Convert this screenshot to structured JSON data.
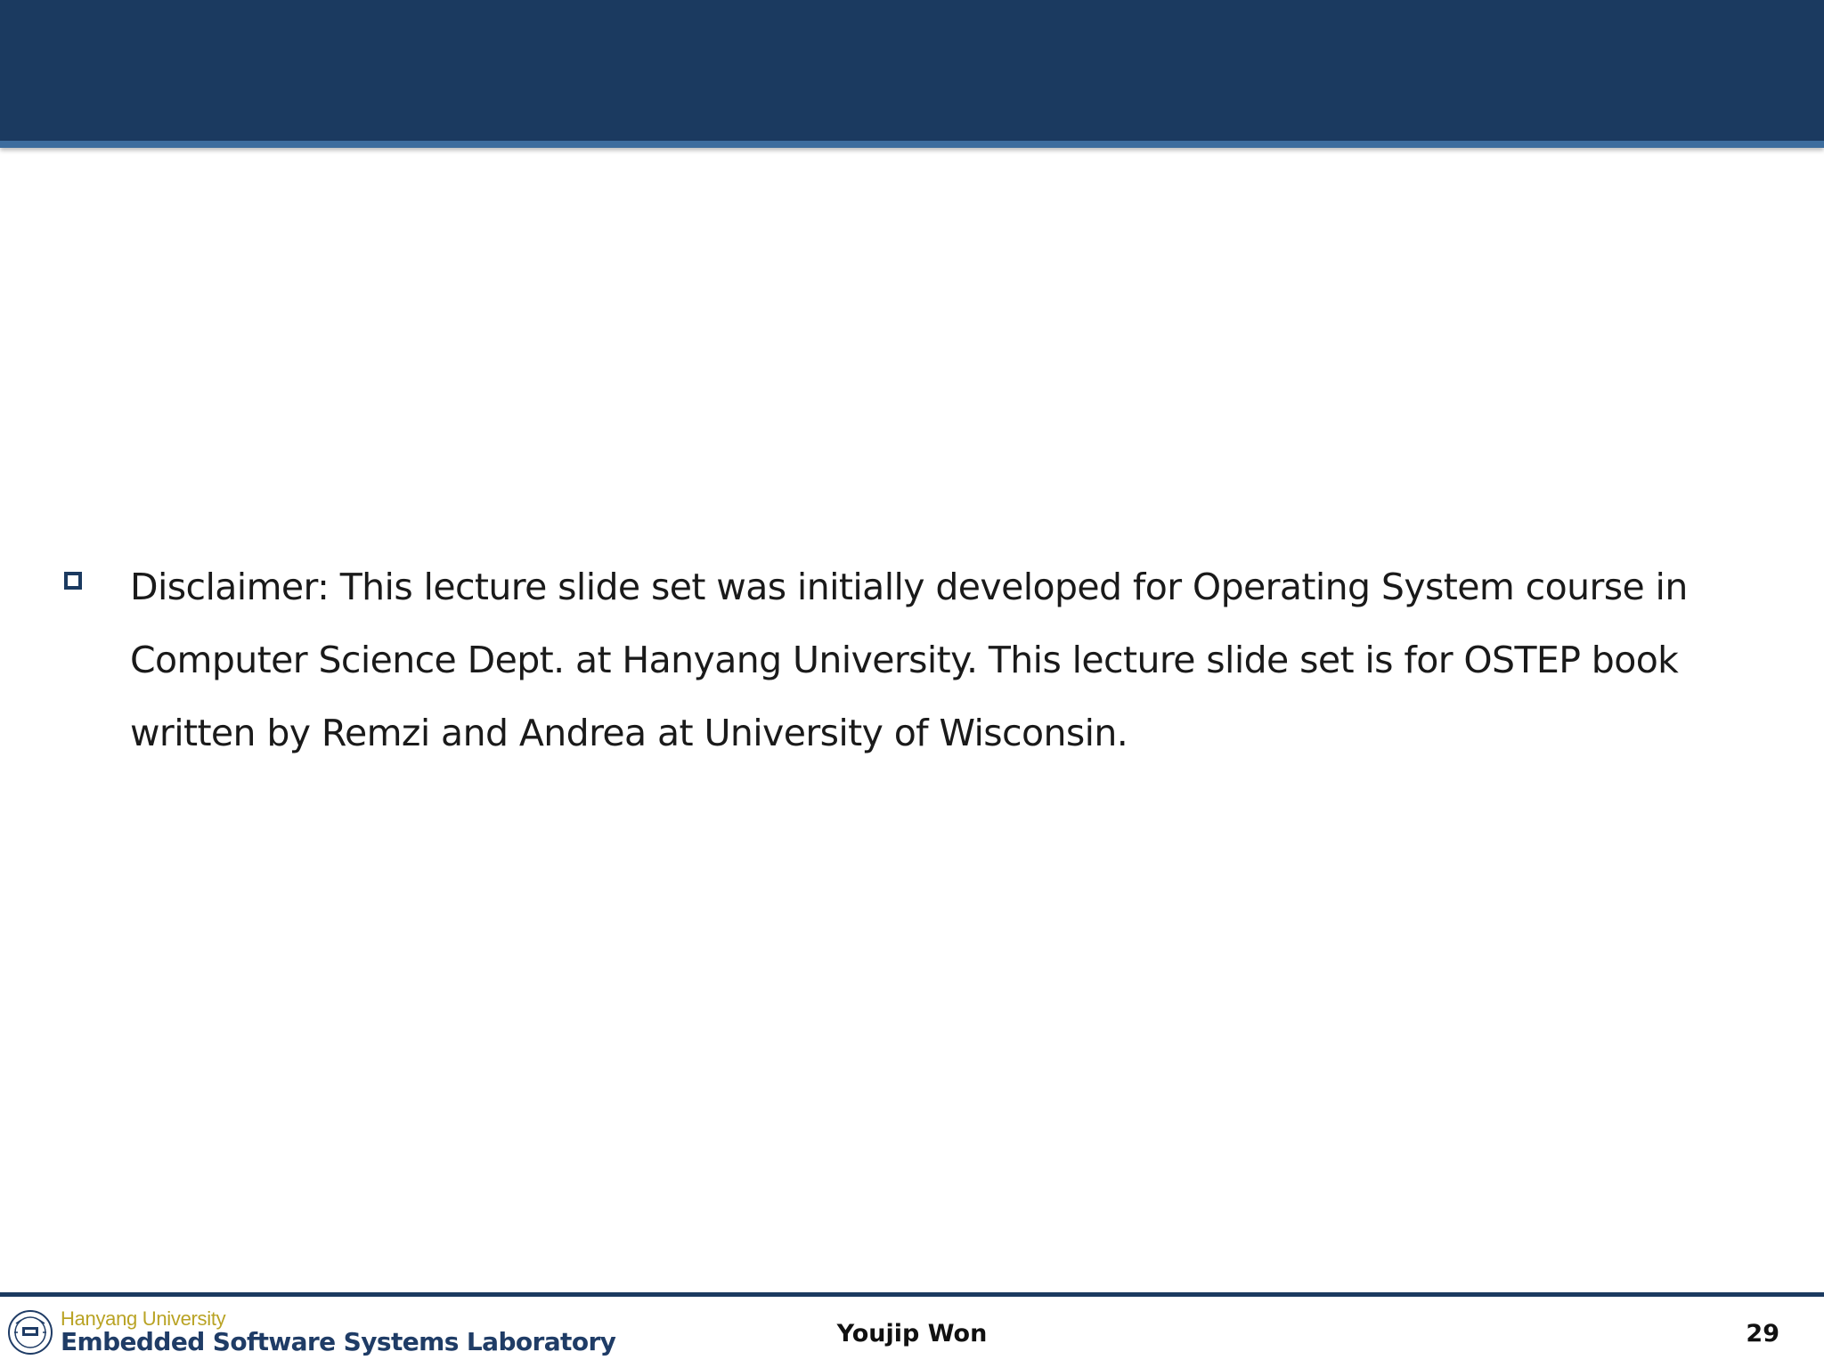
{
  "slide": {
    "title": "",
    "bullets": [
      {
        "text": "Disclaimer: This lecture slide set was initially developed for Operating System course in Computer Science Dept. at Hanyang University. This lecture slide set is for OSTEP book written by Remzi and Andrea at University of Wisconsin."
      }
    ]
  },
  "footer": {
    "logo_university": "Hanyang University",
    "logo_lab": "Embedded Software Systems Laboratory",
    "author": "Youjip Won",
    "page_number": "29"
  },
  "colors": {
    "header": "#1b3a60",
    "header_rule": "#3d6d9e",
    "logo_university": "#b9a324",
    "logo_lab": "#1f3c66"
  }
}
